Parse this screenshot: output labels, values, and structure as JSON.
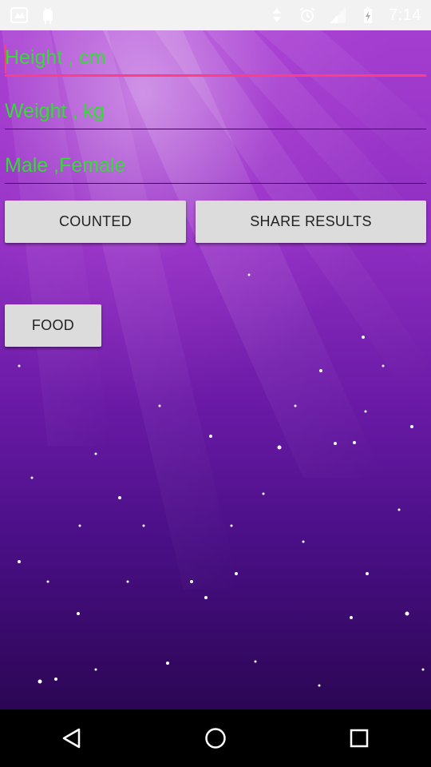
{
  "status_bar": {
    "time": "7:14",
    "left_icons": [
      "image-app-icon",
      "android-icon"
    ],
    "right_icons": [
      "data-transfer-icon",
      "alarm-icon",
      "signal-icon",
      "battery-icon"
    ]
  },
  "form": {
    "height_field": {
      "placeholder": "Height , cm",
      "value": ""
    },
    "weight_field": {
      "placeholder": "Weight , kg",
      "value": ""
    },
    "gender_field": {
      "placeholder": "Male ,Female",
      "value": ""
    }
  },
  "buttons": {
    "counted_label": "COUNTED",
    "share_label": "SHARE RESULTS",
    "food_label": "FOOD"
  },
  "nav_bar": {
    "icons": [
      "back-icon",
      "home-icon",
      "recents-icon"
    ]
  },
  "colors": {
    "text_green": "#33dd33",
    "focus_accent": "#ff3d7f",
    "button_bg": "#dcdcdc",
    "background_purple": "#8f2ec2"
  }
}
